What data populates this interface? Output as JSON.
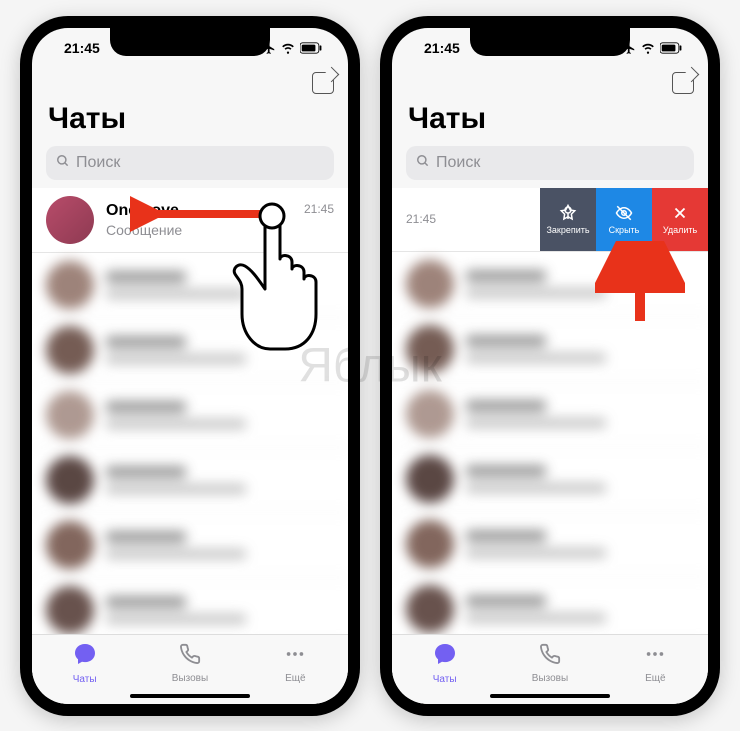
{
  "watermark": "Яблык",
  "statusbar": {
    "time": "21:45"
  },
  "header": {
    "title": "Чаты"
  },
  "search": {
    "placeholder": "Поиск"
  },
  "first_chat": {
    "name": "One Love",
    "message": "Сообщение",
    "time": "21:45"
  },
  "swipe": {
    "time": "21:45",
    "pin_label": "Закрепить",
    "hide_label": "Скрыть",
    "delete_label": "Удалить"
  },
  "tabs": {
    "chats": "Чаты",
    "calls": "Вызовы",
    "more": "Ещё"
  },
  "avatar_colors": {
    "main": "#b84c6a",
    "blur": [
      "#8d6e63",
      "#5d4037",
      "#a1887f",
      "#3e2723",
      "#6d4c41",
      "#4e342e",
      "#795548",
      "#bcaaa4"
    ]
  }
}
